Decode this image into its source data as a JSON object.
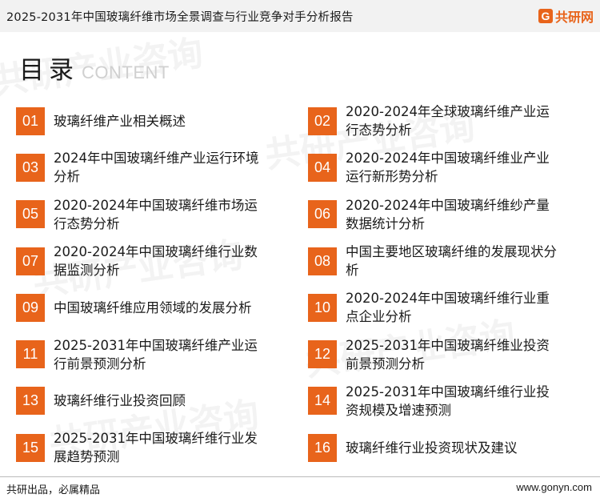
{
  "header": {
    "title": "2025-2031年中国玻璃纤维市场全景调查与行业竞争对手分析报告",
    "brand_mark": "G",
    "brand_name": "共研网"
  },
  "watermark": {
    "text": "共研产业咨询",
    "url_text": "www.gonyn.com"
  },
  "section": {
    "title": "目录",
    "subtitle": "CONTENT"
  },
  "toc": [
    {
      "num": "01",
      "label": "玻璃纤维产业相关概述"
    },
    {
      "num": "02",
      "label": "2020-2024年全球玻璃纤维产业运行态势分析"
    },
    {
      "num": "03",
      "label": "2024年中国玻璃纤维产业运行环境分析"
    },
    {
      "num": "04",
      "label": "2020-2024年中国玻璃纤维业产业运行新形势分析"
    },
    {
      "num": "05",
      "label": "2020-2024年中国玻璃纤维市场运行态势分析"
    },
    {
      "num": "06",
      "label": "2020-2024年中国玻璃纤维纱产量数据统计分析"
    },
    {
      "num": "07",
      "label": "2020-2024年中国玻璃纤维行业数据监测分析"
    },
    {
      "num": "08",
      "label": "中国主要地区玻璃纤维的发展现状分析"
    },
    {
      "num": "09",
      "label": "中国玻璃纤维应用领域的发展分析"
    },
    {
      "num": "10",
      "label": "2020-2024年中国玻璃纤维行业重点企业分析"
    },
    {
      "num": "11",
      "label": "2025-2031年中国玻璃纤维产业运行前景预测分析"
    },
    {
      "num": "12",
      "label": "2025-2031年中国玻璃纤维业投资前景预测分析"
    },
    {
      "num": "13",
      "label": "玻璃纤维行业投资回顾"
    },
    {
      "num": "14",
      "label": "2025-2031年中国玻璃纤维行业投资规模及增速预测"
    },
    {
      "num": "15",
      "label": "2025-2031年中国玻璃纤维行业发展趋势预测"
    },
    {
      "num": "16",
      "label": "玻璃纤维行业投资现状及建议"
    }
  ],
  "footer": {
    "slogan": "共研出品，必属精品",
    "url": "www.gonyn.com"
  },
  "colors": {
    "accent": "#e8641b",
    "header_bg": "#f2f2f2"
  }
}
